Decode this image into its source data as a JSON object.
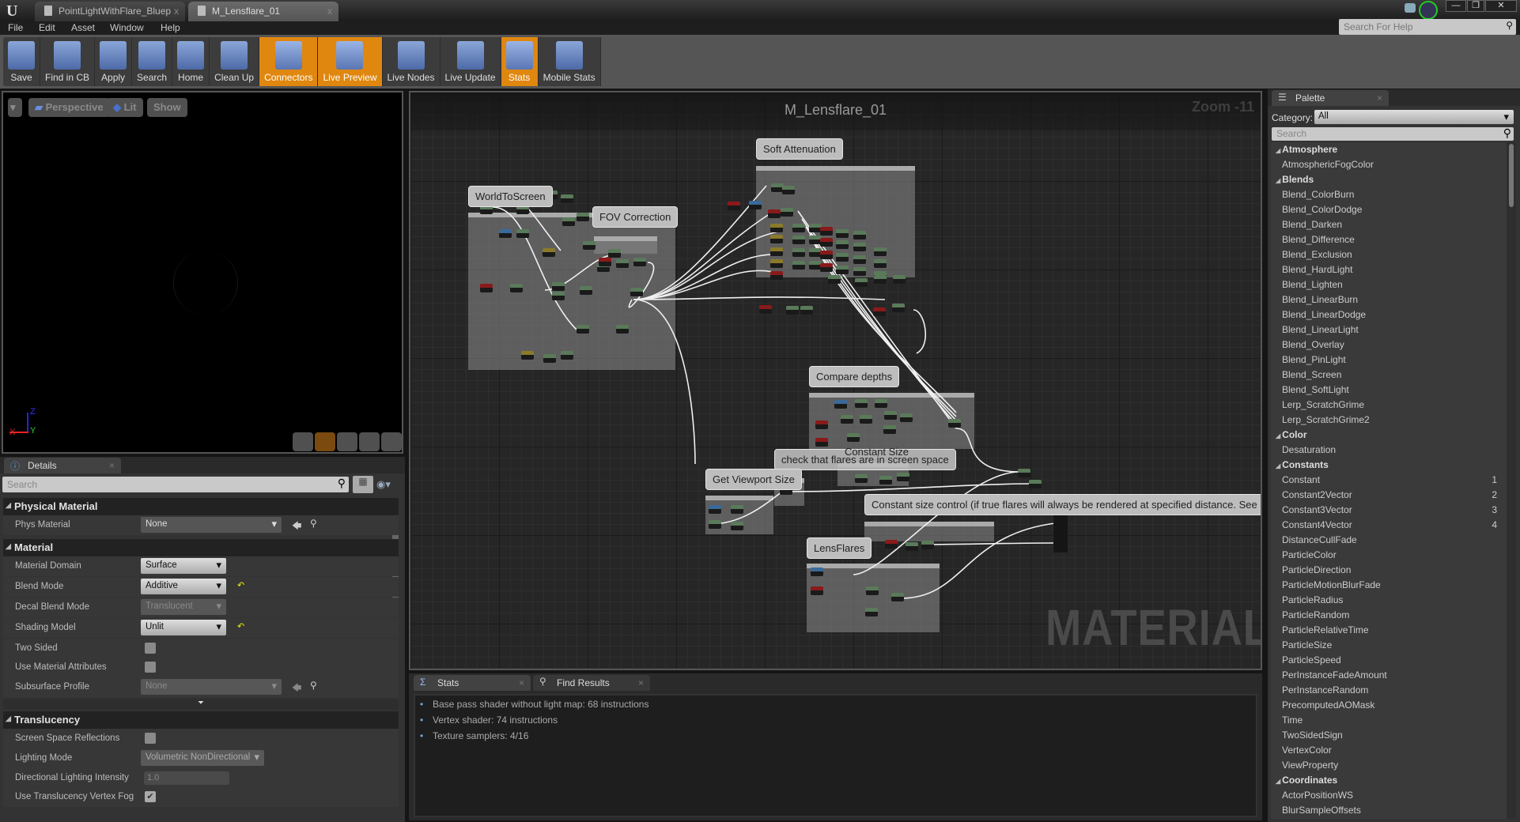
{
  "window": {
    "tabs": [
      {
        "label": "PointLightWithFlare_Bluep"
      },
      {
        "label": "M_Lensflare_01"
      }
    ],
    "help_search_placeholder": "Search For Help"
  },
  "menu": [
    "File",
    "Edit",
    "Asset",
    "Window",
    "Help"
  ],
  "toolbar": [
    {
      "label": "Save",
      "icon": "save-icon",
      "active": false
    },
    {
      "label": "Find in CB",
      "icon": "magnifier-icon",
      "active": false
    },
    {
      "label": "Apply",
      "icon": "checkmark-icon",
      "active": false
    },
    {
      "label": "Search",
      "icon": "binoculars-icon",
      "active": false
    },
    {
      "label": "Home",
      "icon": "home-icon",
      "active": false
    },
    {
      "label": "Clean Up",
      "icon": "broom-icon",
      "active": false
    },
    {
      "label": "Connectors",
      "icon": "connectors-icon",
      "active": true
    },
    {
      "label": "Live Preview",
      "icon": "tv-icon",
      "active": true
    },
    {
      "label": "Live Nodes",
      "icon": "live-nodes-icon",
      "active": false
    },
    {
      "label": "Live Update",
      "icon": "live-update-icon",
      "active": false
    },
    {
      "label": "Stats",
      "icon": "bar-stats-icon",
      "active": true
    },
    {
      "label": "Mobile Stats",
      "icon": "mobile-stats-icon",
      "active": false
    }
  ],
  "viewport": {
    "perspective": "Perspective",
    "lit": "Lit",
    "show": "Show",
    "axis": {
      "x": "X",
      "y": "Y",
      "z": "Z"
    }
  },
  "details": {
    "tab": "Details",
    "search_placeholder": "Search",
    "physical_material": {
      "title": "Physical Material",
      "phys_material_label": "Phys Material",
      "phys_material_value": "None"
    },
    "material": {
      "title": "Material",
      "domain_label": "Material Domain",
      "domain": "Surface",
      "blend_label": "Blend Mode",
      "blend": "Additive",
      "decal_label": "Decal Blend Mode",
      "decal": "Translucent",
      "shading_label": "Shading Model",
      "shading": "Unlit",
      "two_sided_label": "Two Sided",
      "two_sided": false,
      "use_attr_label": "Use Material Attributes",
      "use_attr": false,
      "subsurface_label": "Subsurface Profile",
      "subsurface": "None"
    },
    "translucency": {
      "title": "Translucency",
      "ssr_label": "Screen Space Reflections",
      "ssr": false,
      "lighting_label": "Lighting Mode",
      "lighting": "Volumetric NonDirectional",
      "dli_label": "Directional Lighting Intensity",
      "dli": "1.0",
      "fog_label": "Use Translucency Vertex Fog",
      "fog": true
    }
  },
  "graph": {
    "title": "M_Lensflare_01",
    "zoom": "Zoom -11",
    "watermark": "MATERIAL",
    "comments": [
      "WorldToScreen",
      "FOV Correction",
      "Soft Attenuation",
      "Compare depths",
      "Constant Size",
      "check that flares are in screen space",
      "Get Viewport Size",
      "Constant size control (if true flares will always be rendered at specified distance. See D",
      "LensFlares"
    ]
  },
  "stats": {
    "tabs": [
      "Stats",
      "Find Results"
    ],
    "lines": [
      "Base pass shader without light map: 68 instructions",
      "Vertex shader: 74 instructions",
      "Texture samplers: 4/16"
    ]
  },
  "palette": {
    "tab": "Palette",
    "category_label": "Category:",
    "category": "All",
    "search_placeholder": "Search",
    "items": [
      {
        "t": "Atmosphere",
        "cat": true
      },
      {
        "t": "AtmosphericFogColor"
      },
      {
        "t": "Blends",
        "cat": true
      },
      {
        "t": "Blend_ColorBurn"
      },
      {
        "t": "Blend_ColorDodge"
      },
      {
        "t": "Blend_Darken"
      },
      {
        "t": "Blend_Difference"
      },
      {
        "t": "Blend_Exclusion"
      },
      {
        "t": "Blend_HardLight"
      },
      {
        "t": "Blend_Lighten"
      },
      {
        "t": "Blend_LinearBurn"
      },
      {
        "t": "Blend_LinearDodge"
      },
      {
        "t": "Blend_LinearLight"
      },
      {
        "t": "Blend_Overlay"
      },
      {
        "t": "Blend_PinLight"
      },
      {
        "t": "Blend_Screen"
      },
      {
        "t": "Blend_SoftLight"
      },
      {
        "t": "Lerp_ScratchGrime"
      },
      {
        "t": "Lerp_ScratchGrime2"
      },
      {
        "t": "Color",
        "cat": true
      },
      {
        "t": "Desaturation"
      },
      {
        "t": "Constants",
        "cat": true
      },
      {
        "t": "Constant",
        "hk": "1"
      },
      {
        "t": "Constant2Vector",
        "hk": "2"
      },
      {
        "t": "Constant3Vector",
        "hk": "3"
      },
      {
        "t": "Constant4Vector",
        "hk": "4"
      },
      {
        "t": "DistanceCullFade"
      },
      {
        "t": "ParticleColor"
      },
      {
        "t": "ParticleDirection"
      },
      {
        "t": "ParticleMotionBlurFade"
      },
      {
        "t": "ParticleRadius"
      },
      {
        "t": "ParticleRandom"
      },
      {
        "t": "ParticleRelativeTime"
      },
      {
        "t": "ParticleSize"
      },
      {
        "t": "ParticleSpeed"
      },
      {
        "t": "PerInstanceFadeAmount"
      },
      {
        "t": "PerInstanceRandom"
      },
      {
        "t": "PrecomputedAOMask"
      },
      {
        "t": "Time"
      },
      {
        "t": "TwoSidedSign"
      },
      {
        "t": "VertexColor"
      },
      {
        "t": "ViewProperty"
      },
      {
        "t": "Coordinates",
        "cat": true
      },
      {
        "t": "ActorPositionWS"
      },
      {
        "t": "BlurSampleOffsets"
      }
    ]
  },
  "colors": {
    "accent": "#e0870f",
    "node_green": "#5a7a5a",
    "node_red": "#8a1a1a",
    "node_blue": "#3a6a9a",
    "node_gold": "#8a7a2a"
  }
}
